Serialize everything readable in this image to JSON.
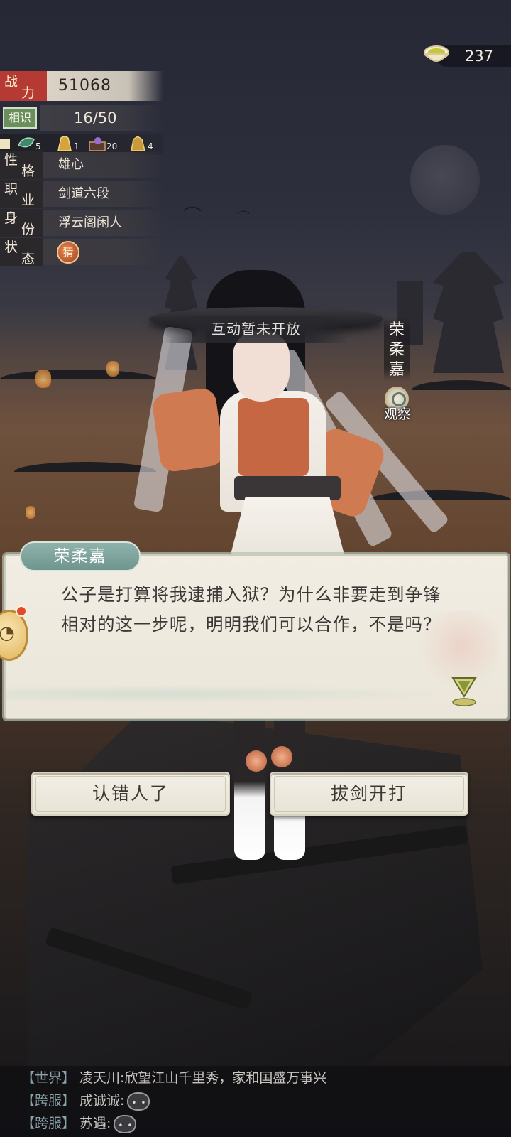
{
  "currency": {
    "icon": "tea-bowl-icon",
    "value": "237"
  },
  "stats": {
    "power": {
      "label_a": "战",
      "label_b": "力",
      "value": "51068"
    },
    "acquaintance": {
      "label": "相识",
      "value": "16/50"
    },
    "items": [
      {
        "icon": "jade-leaf-icon",
        "count": "5"
      },
      {
        "icon": "gold-ingot-icon",
        "count": "1"
      },
      {
        "icon": "gift-box-icon",
        "count": "20"
      },
      {
        "icon": "gold-rock-icon",
        "count": "4"
      }
    ],
    "attributes": [
      {
        "k1": "性",
        "k2": "格",
        "value": "雄心"
      },
      {
        "k1": "职",
        "k2": "业",
        "value": "剑道六段"
      },
      {
        "k1": "身",
        "k2": "份",
        "value": "浮云阁闲人"
      },
      {
        "k1": "状",
        "k2": "态",
        "value": ""
      }
    ],
    "status_badge": "猜"
  },
  "interaction_banner": "互动暂未开放",
  "character": {
    "name_chars": [
      "荣",
      "柔",
      "嘉"
    ],
    "observe_label": "观察"
  },
  "dialog": {
    "speaker": "荣柔嘉",
    "text": "公子是打算将我逮捕入狱？为什么非要走到争锋相对的这一步呢，明明我们可以合作，不是吗？"
  },
  "choices": [
    {
      "label": "认错人了"
    },
    {
      "label": "拔剑开打"
    }
  ],
  "chat": [
    {
      "channel": "【世界】",
      "name": "凌天川:",
      "message": "欣望江山千里秀，家和国盛万事兴",
      "emoji": ""
    },
    {
      "channel": "【跨服】",
      "name": "成诚诚:",
      "message": "",
      "emoji": "annoyed-face-icon"
    },
    {
      "channel": "【跨服】",
      "name": "苏遇:",
      "message": "",
      "emoji": "sulk-face-icon"
    }
  ],
  "colors": {
    "power_tag": "#b53a34",
    "acquaintance_tag": "#6a8f5c",
    "dialog_tab": "#7ea39d"
  }
}
